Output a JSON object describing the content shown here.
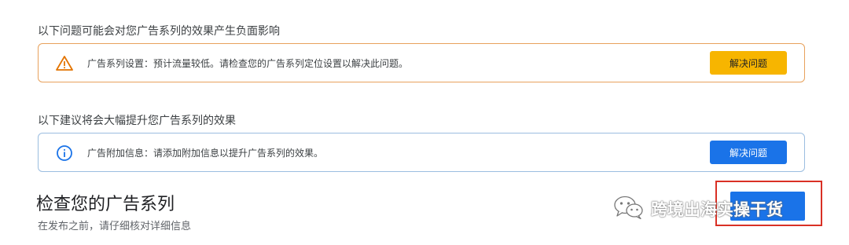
{
  "negative_section": {
    "heading": "以下问题可能会对您广告系列的效果产生负面影响",
    "alert_text": "广告系列设置：预计流量较低。请检查您的广告系列定位设置以解决此问题。",
    "button_label": "解决问题",
    "icon": "warning-icon",
    "accent_color": "#e8a15c",
    "button_color": "#f7b500"
  },
  "improve_section": {
    "heading": "以下建议将会大幅提升您广告系列的效果",
    "alert_text": "广告附加信息：请添加附加信息以提升广告系列的效果。",
    "button_label": "解决问题",
    "icon": "info-icon",
    "accent_color": "#9bbde0",
    "button_color": "#1a73e8"
  },
  "review": {
    "title": "检查您的广告系列",
    "subtitle": "在发布之前，请仔细核对详细信息"
  },
  "watermark": {
    "text": "跨境出海实操干货",
    "icon": "wechat-icon"
  },
  "highlight_color": "#d93025"
}
